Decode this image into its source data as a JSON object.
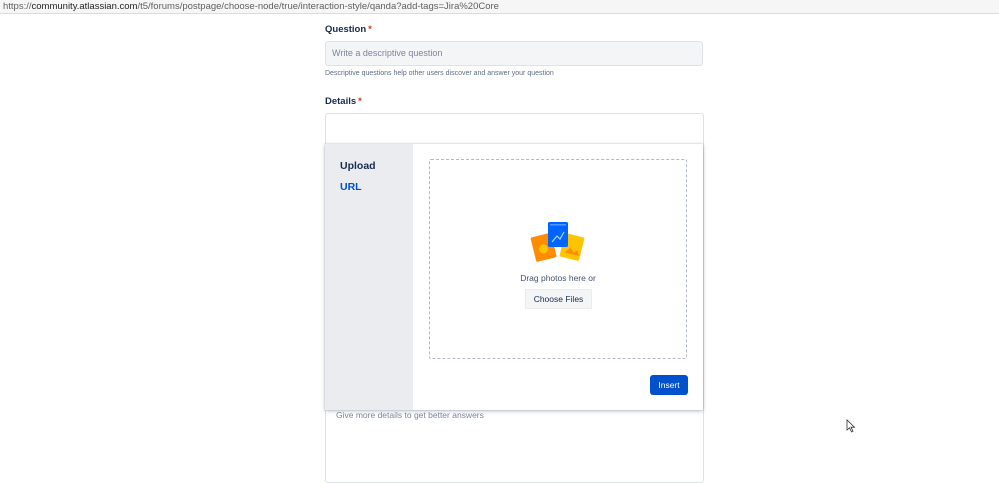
{
  "browser": {
    "url_prefix": "https://",
    "url_host": "community.atlassian.com",
    "url_path": "/t5/forums/postpage/choose-node/true/interaction-style/qanda?add-tags=Jira%20Core"
  },
  "form": {
    "question_label": "Question",
    "required_mark": "*",
    "question_placeholder": "Write a descriptive question",
    "question_helper": "Descriptive questions help other users discover and answer your question",
    "details_label": "Details",
    "details_placeholder": "Give more details to get better answers"
  },
  "upload_dialog": {
    "tabs": [
      "Upload",
      "URL"
    ],
    "drag_text": "Drag photos here or",
    "choose_button": "Choose Files",
    "insert_button": "Insert",
    "icon": "photo-stack-icon"
  },
  "colors": {
    "primary": "#0052cc",
    "required": "#de350b",
    "sidebar_bg": "#ebecf0"
  }
}
